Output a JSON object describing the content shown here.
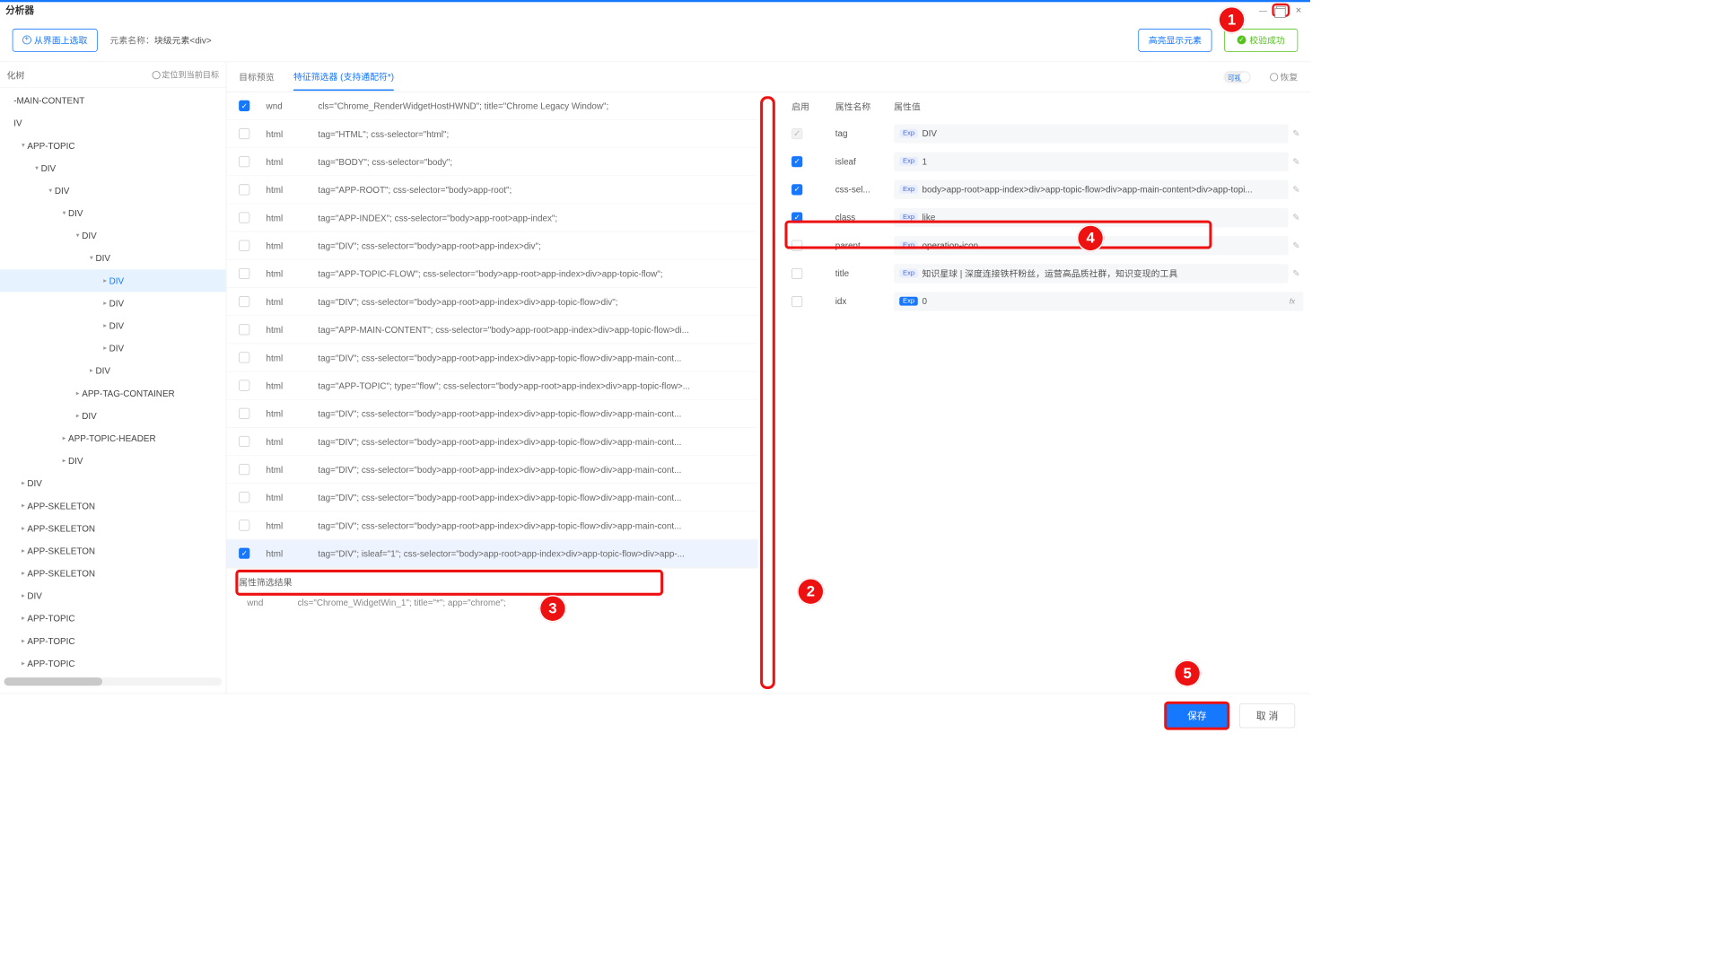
{
  "window": {
    "title": "分析器"
  },
  "toolbar": {
    "pick_label": "从界面上选取",
    "elem_name_label": "元素名称：",
    "elem_name_value": "块级元素<div>",
    "highlight_label": "高亮显示元素",
    "validate_label": "校验成功"
  },
  "leftpane": {
    "title": "化树",
    "locate_label": "定位到当前目标"
  },
  "tree": [
    {
      "indent": 0,
      "caret": "",
      "label": "-MAIN-CONTENT"
    },
    {
      "indent": 0,
      "caret": "",
      "label": "IV"
    },
    {
      "indent": 1,
      "caret": "▾",
      "label": "APP-TOPIC"
    },
    {
      "indent": 2,
      "caret": "▾",
      "label": "DIV"
    },
    {
      "indent": 3,
      "caret": "▾",
      "label": "DIV"
    },
    {
      "indent": 4,
      "caret": "▾",
      "label": "DIV"
    },
    {
      "indent": 5,
      "caret": "▾",
      "label": "DIV"
    },
    {
      "indent": 6,
      "caret": "▾",
      "label": "DIV"
    },
    {
      "indent": 7,
      "caret": "▸",
      "label": "DIV",
      "hl": true
    },
    {
      "indent": 7,
      "caret": "▸",
      "label": "DIV"
    },
    {
      "indent": 7,
      "caret": "▸",
      "label": "DIV"
    },
    {
      "indent": 7,
      "caret": "▸",
      "label": "DIV"
    },
    {
      "indent": 6,
      "caret": "▸",
      "label": "DIV"
    },
    {
      "indent": 5,
      "caret": "▸",
      "label": "APP-TAG-CONTAINER"
    },
    {
      "indent": 5,
      "caret": "▸",
      "label": "DIV"
    },
    {
      "indent": 4,
      "caret": "▸",
      "label": "APP-TOPIC-HEADER"
    },
    {
      "indent": 4,
      "caret": "▸",
      "label": "DIV"
    },
    {
      "indent": 1,
      "caret": "▸",
      "label": "DIV"
    },
    {
      "indent": 1,
      "caret": "▸",
      "label": "APP-SKELETON"
    },
    {
      "indent": 1,
      "caret": "▸",
      "label": "APP-SKELETON"
    },
    {
      "indent": 1,
      "caret": "▸",
      "label": "APP-SKELETON"
    },
    {
      "indent": 1,
      "caret": "▸",
      "label": "APP-SKELETON"
    },
    {
      "indent": 1,
      "caret": "▸",
      "label": "DIV"
    },
    {
      "indent": 1,
      "caret": "▸",
      "label": "APP-TOPIC"
    },
    {
      "indent": 1,
      "caret": "▸",
      "label": "APP-TOPIC"
    },
    {
      "indent": 1,
      "caret": "▸",
      "label": "APP-TOPIC"
    }
  ],
  "tabs": {
    "preview": "目标预览",
    "selector": "特征筛选器 (支持通配符*)",
    "vis_label": "可视化",
    "restore": "恢复"
  },
  "rows": [
    {
      "on": true,
      "tag": "wnd",
      "sel": "cls=\"Chrome_RenderWidgetHostHWND\"; title=\"Chrome Legacy Window\";"
    },
    {
      "on": false,
      "tag": "html",
      "sel": "tag=\"HTML\"; css-selector=\"html\";"
    },
    {
      "on": false,
      "tag": "html",
      "sel": "tag=\"BODY\"; css-selector=\"body\";"
    },
    {
      "on": false,
      "tag": "html",
      "sel": "tag=\"APP-ROOT\"; css-selector=\"body>app-root\";"
    },
    {
      "on": false,
      "tag": "html",
      "sel": "tag=\"APP-INDEX\"; css-selector=\"body>app-root>app-index\";"
    },
    {
      "on": false,
      "tag": "html",
      "sel": "tag=\"DIV\"; css-selector=\"body>app-root>app-index>div\";"
    },
    {
      "on": false,
      "tag": "html",
      "sel": "tag=\"APP-TOPIC-FLOW\"; css-selector=\"body>app-root>app-index>div>app-topic-flow\";"
    },
    {
      "on": false,
      "tag": "html",
      "sel": "tag=\"DIV\"; css-selector=\"body>app-root>app-index>div>app-topic-flow>div\";"
    },
    {
      "on": false,
      "tag": "html",
      "sel": "tag=\"APP-MAIN-CONTENT\"; css-selector=\"body>app-root>app-index>div>app-topic-flow>di..."
    },
    {
      "on": false,
      "tag": "html",
      "sel": "tag=\"DIV\"; css-selector=\"body>app-root>app-index>div>app-topic-flow>div>app-main-cont..."
    },
    {
      "on": false,
      "tag": "html",
      "sel": "tag=\"APP-TOPIC\"; type=\"flow\"; css-selector=\"body>app-root>app-index>div>app-topic-flow>..."
    },
    {
      "on": false,
      "tag": "html",
      "sel": "tag=\"DIV\"; css-selector=\"body>app-root>app-index>div>app-topic-flow>div>app-main-cont..."
    },
    {
      "on": false,
      "tag": "html",
      "sel": "tag=\"DIV\"; css-selector=\"body>app-root>app-index>div>app-topic-flow>div>app-main-cont..."
    },
    {
      "on": false,
      "tag": "html",
      "sel": "tag=\"DIV\"; css-selector=\"body>app-root>app-index>div>app-topic-flow>div>app-main-cont..."
    },
    {
      "on": false,
      "tag": "html",
      "sel": "tag=\"DIV\"; css-selector=\"body>app-root>app-index>div>app-topic-flow>div>app-main-cont..."
    },
    {
      "on": false,
      "tag": "html",
      "sel": "tag=\"DIV\"; css-selector=\"body>app-root>app-index>div>app-topic-flow>div>app-main-cont..."
    },
    {
      "on": true,
      "tag": "html",
      "sel": "tag=\"DIV\"; isleaf=\"1\"; css-selector=\"body>app-root>app-index>div>app-topic-flow>div>app-...",
      "selRow": true
    }
  ],
  "attr": {
    "head_enable": "启用",
    "head_name": "属性名称",
    "head_value": "属性值",
    "rows": [
      {
        "cb": "dim",
        "name": "tag",
        "badge": "Exp",
        "val": "DIV",
        "edit": true
      },
      {
        "cb": "on",
        "name": "isleaf",
        "badge": "Exp",
        "val": "1",
        "edit": true
      },
      {
        "cb": "on",
        "name": "css-sel...",
        "badge": "Exp",
        "val": "body>app-root>app-index>div>app-topic-flow>div>app-main-content>div>app-topi...",
        "edit": true
      },
      {
        "cb": "on",
        "name": "class",
        "badge": "Exp",
        "val": "like",
        "edit": true,
        "frame": true
      },
      {
        "cb": "off",
        "name": "parent...",
        "badge": "Exp",
        "val": "operation-icon",
        "edit": true
      },
      {
        "cb": "off",
        "name": "title",
        "badge": "Exp",
        "val": "知识星球 | 深度连接铁杆粉丝，运营高品质社群，知识变现的工具",
        "edit": true
      },
      {
        "cb": "off",
        "name": "idx",
        "badge": "ExpSolid",
        "val": "0",
        "fx": true
      }
    ]
  },
  "result": {
    "title": "属性筛选结果",
    "k": "wnd",
    "v": "cls=\"Chrome_WidgetWin_1\"; title=\"*\"; app=\"chrome\";"
  },
  "footer": {
    "save": "保存",
    "cancel": "取 消"
  }
}
